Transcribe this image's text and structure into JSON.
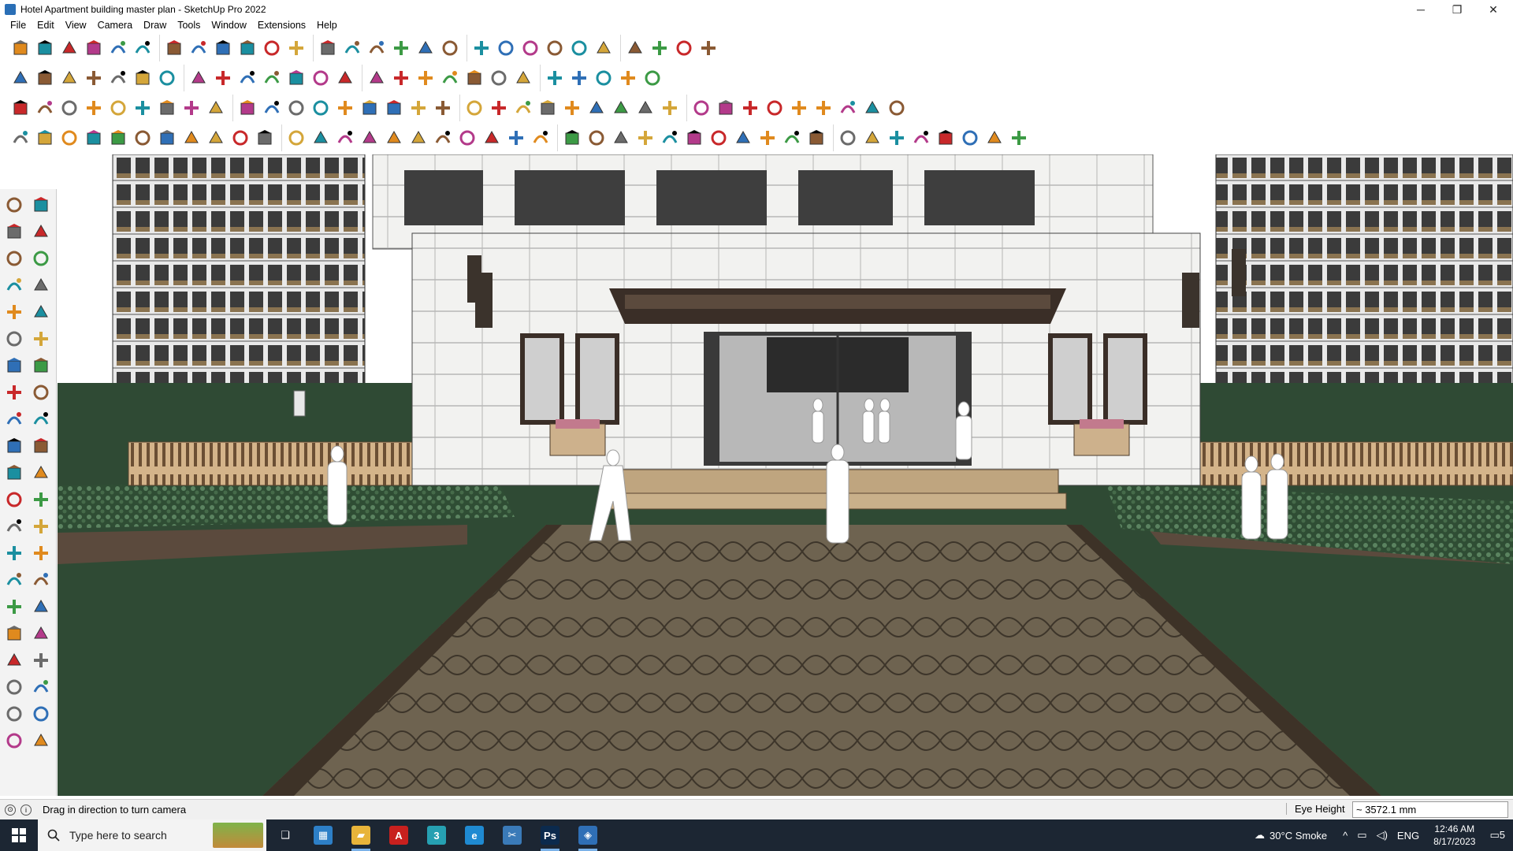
{
  "window": {
    "title": "Hotel Apartment building master plan - SketchUp Pro 2022",
    "controls": [
      "─",
      "❐",
      "✕"
    ]
  },
  "menu": [
    "File",
    "Edit",
    "View",
    "Camera",
    "Draw",
    "Tools",
    "Window",
    "Extensions",
    "Help"
  ],
  "toolbars": {
    "row1_icons": [
      "zoom-extents",
      "select",
      "eraser",
      "pencil-line",
      "shapes-dropdown",
      "push-pull",
      "follow-me",
      "move",
      "rotate",
      "scale",
      "tape-measure",
      "text",
      "paint-bucket",
      "orbit",
      "pan",
      "zoom",
      "zoom-window",
      "layer",
      "section",
      "styles",
      "scenes",
      "components",
      "materials",
      "add-location",
      "sandbox",
      "undo",
      "redo",
      "warehouse"
    ],
    "row2_icons": [
      "box-solid",
      "box-xray",
      "box-wire",
      "push-pull-a",
      "push-pull-b",
      "push-pull-c",
      "push-pull-d",
      "push-pull-e",
      "push-pull-f",
      "push-pull-g",
      "curve",
      "section-cut-a",
      "section-cut-b",
      "section-cut-c",
      "plane-a",
      "plane-b",
      "house-a",
      "house-b",
      "house-c",
      "house-d",
      "house-e",
      "house-f",
      "fredo-tools",
      "tag",
      "pen",
      "loop-shapes"
    ],
    "row3_icons": [
      "cube-blue",
      "plane-blue",
      "plane-yellow",
      "label-active",
      "rotate-orange",
      "square-red",
      "rect-orange",
      "page",
      "wood-block",
      "chain",
      "corner",
      "nodes-red",
      "cross-red",
      "cross-green",
      "cross-blue",
      "cone-teal",
      "cone-teal-2",
      "warning",
      "spiral",
      "rope",
      "knot",
      "move-grid",
      "cup-brown",
      "loop",
      "multi-green",
      "bunny-a",
      "bunny-b",
      "cube-red",
      "gears",
      "monitor",
      "grid-orange",
      "grid-yellow",
      "grid-gold",
      "scatter",
      "dots",
      "matrix"
    ],
    "row4_icons": [
      "bezier-a",
      "bezier-b",
      "crane",
      "ruby-red",
      "pen-a",
      "pen-b",
      "pipe",
      "sphere",
      "tube",
      "ribbon",
      "stair-a",
      "stair-b",
      "stair-c",
      "spring",
      "cut",
      "offset",
      "wall",
      "box-tool",
      "profile-a",
      "profile-b",
      "profile-c",
      "profile-d",
      "profile-e",
      "profile-f",
      "profile-g",
      "profile-h",
      "profile-i",
      "profile-j",
      "profile-k",
      "profile-l",
      "profile-m",
      "profile-n",
      "profile-o",
      "profile-p",
      "profile-q",
      "profile-r",
      "profile-s",
      "profile-t",
      "profile-u",
      "profile-v",
      "profile-w"
    ],
    "left_icons": [
      "select-arrow",
      "orbit-lasso",
      "paint-bucket",
      "eraser",
      "components",
      "tape",
      "line",
      "freehand",
      "rectangle",
      "rotated-rectangle",
      "circle",
      "polygon",
      "arc",
      "arc-2",
      "pie",
      "arc-3",
      "move",
      "push-pull",
      "rotate",
      "follow-me",
      "scale",
      "offset",
      "tape-measure",
      "dimension",
      "protractor",
      "text",
      "axes",
      "3d-text",
      "orbit",
      "pan",
      "zoom",
      "zoom-window",
      "zoom-extents",
      "previous",
      "position-camera",
      "look-around",
      "walk",
      "section-plane",
      "layers",
      "styles",
      "scenes",
      "shadows"
    ]
  },
  "viewport": {
    "scene": "hotel-entrance-3d-model"
  },
  "status": {
    "hint": "Drag in direction to turn camera",
    "vcb_label": "Eye Height",
    "vcb_value": "~ 3572.1 mm"
  },
  "taskbar": {
    "search_placeholder": "Type here to search",
    "apps": [
      {
        "name": "task-view",
        "glyph": "❑",
        "color": "#1c2633"
      },
      {
        "name": "calculator",
        "glyph": "▦",
        "color": "#2d7fc7"
      },
      {
        "name": "file-explorer",
        "glyph": "▰",
        "color": "#e8b43a"
      },
      {
        "name": "autocad",
        "glyph": "A",
        "color": "#c8201e"
      },
      {
        "name": "3dsmax",
        "glyph": "3",
        "color": "#26a0b2"
      },
      {
        "name": "edge",
        "glyph": "e",
        "color": "#1f8ad2"
      },
      {
        "name": "snipping",
        "glyph": "✂",
        "color": "#3a7ab8"
      },
      {
        "name": "photoshop",
        "glyph": "Ps",
        "color": "#0b2a4d"
      },
      {
        "name": "sketchup",
        "glyph": "◈",
        "color": "#2f6fb6"
      }
    ],
    "weather": "30°C  Smoke",
    "language": "ENG",
    "time": "12:46 AM",
    "date": "8/17/2023",
    "notifications": "5"
  }
}
